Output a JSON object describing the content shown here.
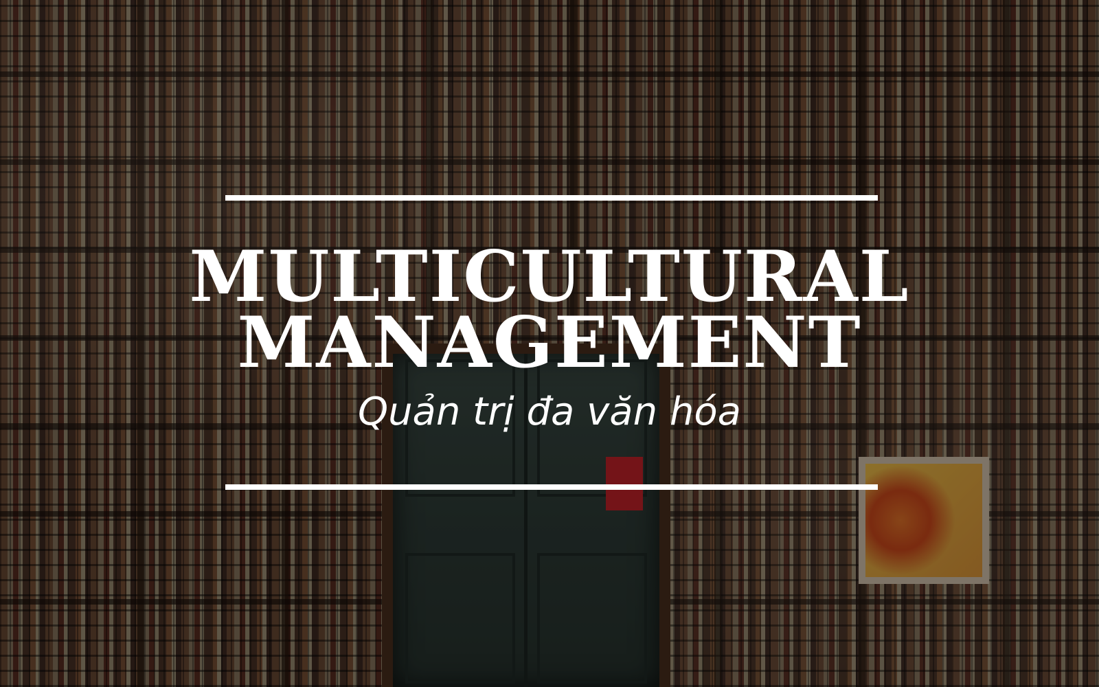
{
  "title": {
    "line1": "MULTICULTURAL",
    "line2": "MANAGEMENT"
  },
  "subtitle": "Quản trị đa văn hóa",
  "colors": {
    "text": "#ffffff",
    "rule": "#ffffff",
    "overlay": "rgba(0,0,0,0.42)",
    "door": "#2f3d38",
    "door_sign": "#c8242a"
  },
  "background": {
    "subject": "wall of old stacked books with a green wooden door in the center"
  }
}
